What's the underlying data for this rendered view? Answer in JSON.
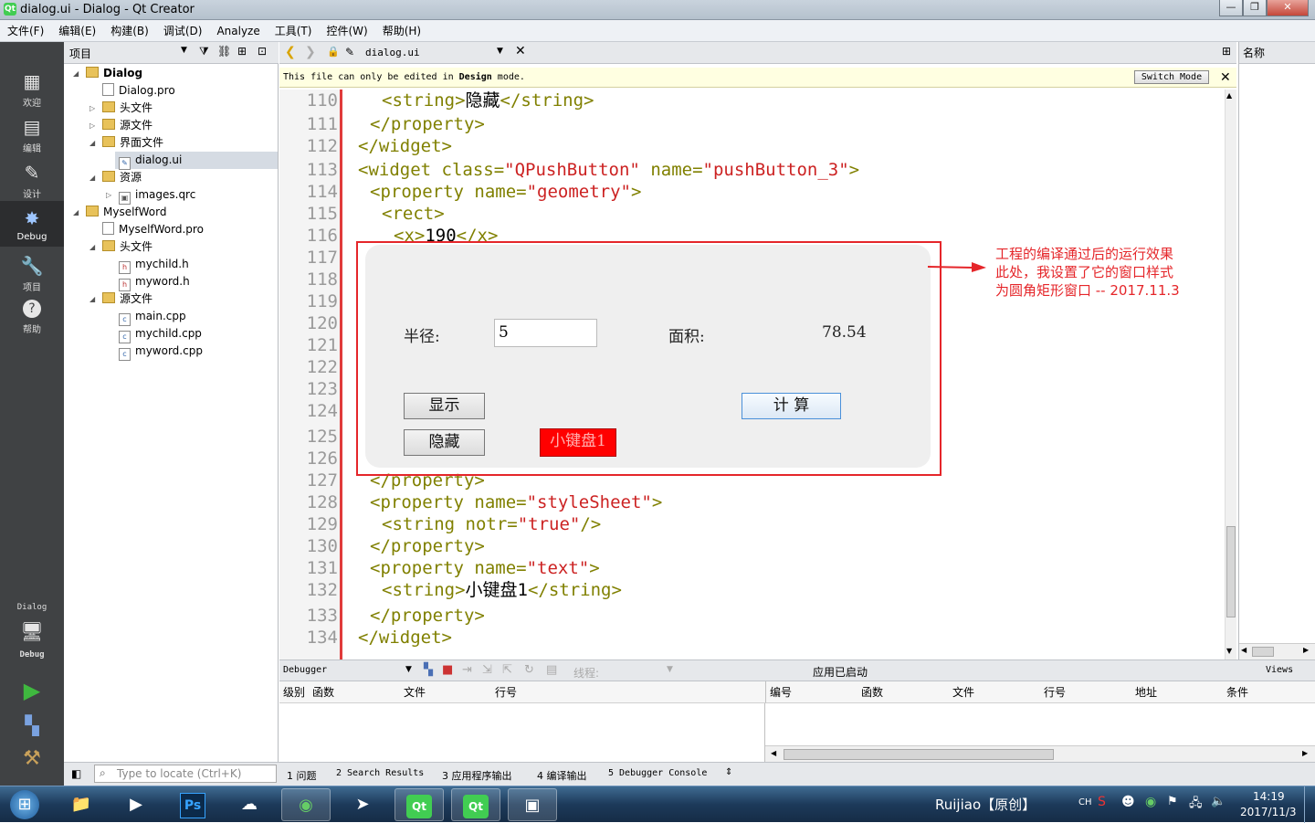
{
  "window": {
    "title": "dialog.ui - Dialog - Qt Creator",
    "app_icon_text": "Qt"
  },
  "menu": [
    "文件(F)",
    "编辑(E)",
    "构建(B)",
    "调试(D)",
    "Analyze",
    "工具(T)",
    "控件(W)",
    "帮助(H)"
  ],
  "modes": [
    {
      "label": "欢迎",
      "icon": "▦"
    },
    {
      "label": "编辑",
      "icon": "▤"
    },
    {
      "label": "设计",
      "icon": "✎"
    },
    {
      "label": "Debug",
      "icon": "✸"
    },
    {
      "label": "项目",
      "icon": "🔧"
    },
    {
      "label": "帮助",
      "icon": "?"
    }
  ],
  "run_target": {
    "project": "Dialog",
    "config": "Debug"
  },
  "project_panel": {
    "title": "项目"
  },
  "tree": [
    {
      "label": "Dialog",
      "level": 0,
      "type": "project",
      "arrow": "◢"
    },
    {
      "label": "Dialog.pro",
      "level": 1,
      "type": "file",
      "arrow": ""
    },
    {
      "label": "头文件",
      "level": 1,
      "type": "folder",
      "arrow": "▷"
    },
    {
      "label": "源文件",
      "level": 1,
      "type": "folder",
      "arrow": "▷"
    },
    {
      "label": "界面文件",
      "level": 1,
      "type": "folder",
      "arrow": "◢"
    },
    {
      "label": "dialog.ui",
      "level": 2,
      "type": "file",
      "arrow": ""
    },
    {
      "label": "资源",
      "level": 1,
      "type": "folder",
      "arrow": "◢"
    },
    {
      "label": "images.qrc",
      "level": 2,
      "type": "file",
      "arrow": "▷"
    },
    {
      "label": "MyselfWord",
      "level": 0,
      "type": "project",
      "arrow": "◢"
    },
    {
      "label": "MyselfWord.pro",
      "level": 1,
      "type": "file",
      "arrow": ""
    },
    {
      "label": "头文件",
      "level": 1,
      "type": "folder",
      "arrow": "◢"
    },
    {
      "label": "mychild.h",
      "level": 2,
      "type": "file",
      "arrow": ""
    },
    {
      "label": "myword.h",
      "level": 2,
      "type": "file",
      "arrow": ""
    },
    {
      "label": "源文件",
      "level": 1,
      "type": "folder",
      "arrow": "◢"
    },
    {
      "label": "main.cpp",
      "level": 2,
      "type": "file",
      "arrow": ""
    },
    {
      "label": "mychild.cpp",
      "level": 2,
      "type": "file",
      "arrow": ""
    },
    {
      "label": "myword.cpp",
      "level": 2,
      "type": "file",
      "arrow": ""
    }
  ],
  "editor": {
    "tab": "dialog.ui",
    "info_prefix": "This file can only be edited in ",
    "info_bold": "Design",
    "info_suffix": " mode.",
    "switch_mode": "Switch Mode",
    "line_numbers": [
      "110",
      "111",
      "112",
      "113",
      "114",
      "115",
      "116",
      "117",
      "118",
      "119",
      "120",
      "121",
      "122",
      "123",
      "124",
      "125",
      "126",
      "127",
      "128",
      "129",
      "130",
      "131",
      "132",
      "133",
      "134"
    ],
    "lines": [
      {
        "ln": 0,
        "indent": 3,
        "html_parts": [
          [
            "<string>",
            ""
          ],
          [
            "隐藏",
            "t"
          ],
          [
            "</string>",
            ""
          ]
        ]
      },
      {
        "ln": 1,
        "indent": 2,
        "html_parts": [
          [
            "</property>",
            ""
          ]
        ]
      },
      {
        "ln": 2,
        "indent": 1,
        "html_parts": [
          [
            "</widget>",
            ""
          ]
        ]
      },
      {
        "ln": 3,
        "indent": 1,
        "html_parts": [
          [
            "<widget class=",
            ""
          ],
          [
            "\"QPushButton\"",
            "s"
          ],
          [
            " name=",
            ""
          ],
          [
            "\"pushButton_3\"",
            "s"
          ],
          [
            ">",
            ""
          ]
        ]
      },
      {
        "ln": 4,
        "indent": 2,
        "html_parts": [
          [
            "<property name=",
            ""
          ],
          [
            "\"geometry\"",
            "s"
          ],
          [
            ">",
            ""
          ]
        ]
      },
      {
        "ln": 5,
        "indent": 3,
        "html_parts": [
          [
            "<rect>",
            ""
          ]
        ]
      },
      {
        "ln": 6,
        "indent": 4,
        "html_parts": [
          [
            "<x>",
            ""
          ],
          [
            "190",
            "t"
          ],
          [
            "</x>",
            ""
          ]
        ]
      },
      {
        "ln": 17,
        "indent": 2,
        "html_parts": [
          [
            "</property>",
            ""
          ]
        ]
      },
      {
        "ln": 18,
        "indent": 2,
        "html_parts": [
          [
            "<property name=",
            ""
          ],
          [
            "\"styleSheet\"",
            "s"
          ],
          [
            ">",
            ""
          ]
        ]
      },
      {
        "ln": 19,
        "indent": 3,
        "html_parts": [
          [
            "<string notr=",
            ""
          ],
          [
            "\"true\"",
            "s"
          ],
          [
            "/>",
            ""
          ]
        ]
      },
      {
        "ln": 20,
        "indent": 2,
        "html_parts": [
          [
            "</property>",
            ""
          ]
        ]
      },
      {
        "ln": 21,
        "indent": 2,
        "html_parts": [
          [
            "<property name=",
            ""
          ],
          [
            "\"text\"",
            "s"
          ],
          [
            ">",
            ""
          ]
        ]
      },
      {
        "ln": 22,
        "indent": 3,
        "html_parts": [
          [
            "<string>",
            ""
          ],
          [
            "小键盘1",
            "t"
          ],
          [
            "</string>",
            ""
          ]
        ]
      },
      {
        "ln": 23,
        "indent": 2,
        "html_parts": [
          [
            "</property>",
            ""
          ]
        ]
      },
      {
        "ln": 24,
        "indent": 1,
        "html_parts": [
          [
            "</widget>",
            ""
          ]
        ]
      }
    ]
  },
  "right_panel": {
    "title": "名称"
  },
  "demo_dialog": {
    "radius_label": "半径:",
    "radius_value": "5",
    "area_label": "面积:",
    "area_value": "78.54",
    "show_button": "显示",
    "hide_button": "隐藏",
    "calc_button": "计  算",
    "keypad_button": "小键盘1"
  },
  "annotation": {
    "line1": "工程的编译通过后的运行效果",
    "line2": "此处，我设置了它的窗口样式",
    "line3": "为圆角矩形窗口 -- 2017.11.3"
  },
  "debugger": {
    "combo": "Debugger",
    "thread_label": "线程:",
    "status": "应用已启动",
    "views": "Views",
    "stack_headers": [
      "级别",
      "函数",
      "文件",
      "行号"
    ],
    "break_headers": [
      "编号",
      "函数",
      "文件",
      "行号",
      "地址",
      "条件"
    ]
  },
  "statusbar": {
    "locate_placeholder": "Type to locate (Ctrl+K)",
    "panes": [
      "1 问题",
      "2 Search Results",
      "3 应用程序输出",
      "4 编译输出",
      "5 Debugger Console"
    ]
  },
  "taskbar": {
    "right_text": "Ruijiao【原创】",
    "lang": "CH",
    "time": "14:19",
    "date": "2017/11/3"
  }
}
